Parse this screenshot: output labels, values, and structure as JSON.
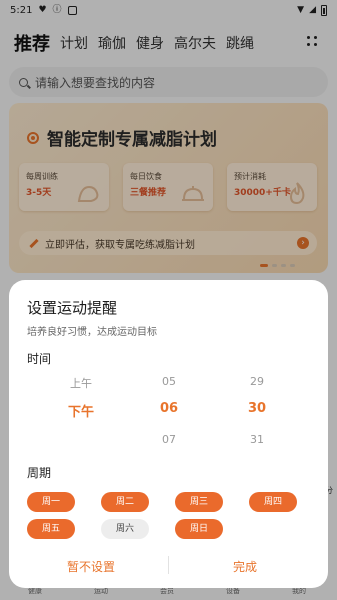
{
  "status_bar": {
    "time": "5:21"
  },
  "nav": {
    "tabs": [
      "推荐",
      "计划",
      "瑜伽",
      "健身",
      "高尔夫",
      "跳绳"
    ]
  },
  "search": {
    "placeholder": "请输入想要查找的内容"
  },
  "banner": {
    "title": "智能定制专属减脂计划",
    "cards": [
      {
        "label": "每周训练",
        "value": "3-5天"
      },
      {
        "label": "每日饮食",
        "value": "三餐推荐"
      },
      {
        "label": "预计消耗",
        "value": "30000+千卡"
      }
    ],
    "cta": "立即评估，获取专属吃练减脂计划"
  },
  "background": {
    "bottom_tabs": [
      "健康",
      "运动",
      "会员",
      "设备",
      "我的"
    ],
    "peek_text": "分"
  },
  "reminder_sheet": {
    "title": "设置运动提醒",
    "subtitle": "培养良好习惯，达成运动目标",
    "time_label": "时间",
    "picker": {
      "period": {
        "above": "上午",
        "selected": "下午"
      },
      "hour": {
        "above": "05",
        "selected": "06",
        "below": "07"
      },
      "minute": {
        "above": "29",
        "selected": "30",
        "below": "31"
      }
    },
    "cycle_label": "周期",
    "days": [
      {
        "label": "周一",
        "selected": true
      },
      {
        "label": "周二",
        "selected": true
      },
      {
        "label": "周三",
        "selected": true
      },
      {
        "label": "周四",
        "selected": true
      },
      {
        "label": "周五",
        "selected": true
      },
      {
        "label": "周六",
        "selected": false
      },
      {
        "label": "周日",
        "selected": true
      }
    ],
    "cancel_label": "暂不设置",
    "confirm_label": "完成"
  },
  "colors": {
    "accent": "#ea6a2c",
    "sheet_bg": "#ffffff",
    "overlay": "rgba(0,0,0,0.28)"
  }
}
